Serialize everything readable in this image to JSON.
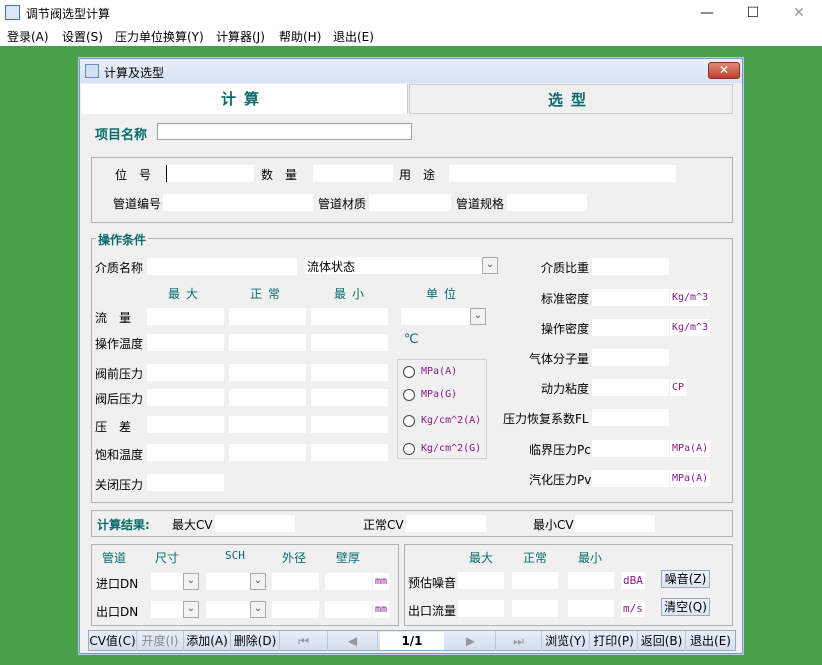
{
  "window": {
    "title": "调节阀选型计算",
    "minimize": "—",
    "maximize": "☐",
    "close": "✕"
  },
  "menu": [
    "登录(A)",
    "设置(S)",
    "压力单位换算(Y)",
    "计算器(J)",
    "帮助(H)",
    "退出(E)"
  ],
  "dialog": {
    "title": "计算及选型",
    "close": "✕"
  },
  "tabs": {
    "calc": "计算",
    "select": "选型"
  },
  "project": {
    "label": "项目名称",
    "value": ""
  },
  "info": {
    "tag_label": "位　号",
    "qty_label": "数　量",
    "use_label": "用　途",
    "pipe_no_label": "管道编号",
    "pipe_mat_label": "管道材质",
    "pipe_spec_label": "管道规格"
  },
  "op": {
    "title": "操作条件",
    "medium_label": "介质名称",
    "state_label": "流体状态",
    "sg_label": "介质比重",
    "col_max": "最大",
    "col_normal": "正常",
    "col_min": "最小",
    "col_unit": "单位",
    "rows": [
      "流　量",
      "操作温度",
      "阀前压力",
      "阀后压力",
      "压　差",
      "饱和温度",
      "关闭压力"
    ],
    "temp_unit": "℃",
    "pressure_units": [
      "MPa(A)",
      "MPa(G)",
      "Kg/cm^2(A)",
      "Kg/cm^2(G)"
    ],
    "right": [
      {
        "label": "标准密度",
        "unit": "Kg/m^3"
      },
      {
        "label": "操作密度",
        "unit": "Kg/m^3"
      },
      {
        "label": "气体分子量",
        "unit": ""
      },
      {
        "label": "动力粘度",
        "unit": "CP"
      },
      {
        "label": "压力恢复系数FL",
        "unit": ""
      },
      {
        "label": "临界压力Pc",
        "unit": "MPa(A)"
      },
      {
        "label": "汽化压力Pv",
        "unit": "MPa(A)"
      }
    ]
  },
  "result": {
    "title": "计算结果:",
    "max": "最大CV",
    "normal": "正常CV",
    "min": "最小CV"
  },
  "pipe": {
    "h_pipe": "管道",
    "h_size": "尺寸",
    "h_sch": "SCH",
    "h_od": "外径",
    "h_wall": "壁厚",
    "inlet": "进口DN",
    "outlet": "出口DN",
    "unit": "mm"
  },
  "noise": {
    "h_max": "最大",
    "h_normal": "正常",
    "h_min": "最小",
    "noise_label": "预估噪音",
    "noise_unit": "dBA",
    "noise_btn": "噪音(Z)",
    "vel_label": "出口流量",
    "vel_unit": "m/s",
    "clear_btn": "清空(Q)"
  },
  "toolbar": {
    "cv": "CV值(C)",
    "open": "开度(I)",
    "add": "添加(A)",
    "del": "删除(D)",
    "first": "⏮",
    "prev": "◀",
    "page": "1/1",
    "next": "▶",
    "last": "⏭",
    "browse": "浏览(Y)",
    "print": "打印(P)",
    "back": "返回(B)",
    "exit": "退出(E)"
  }
}
